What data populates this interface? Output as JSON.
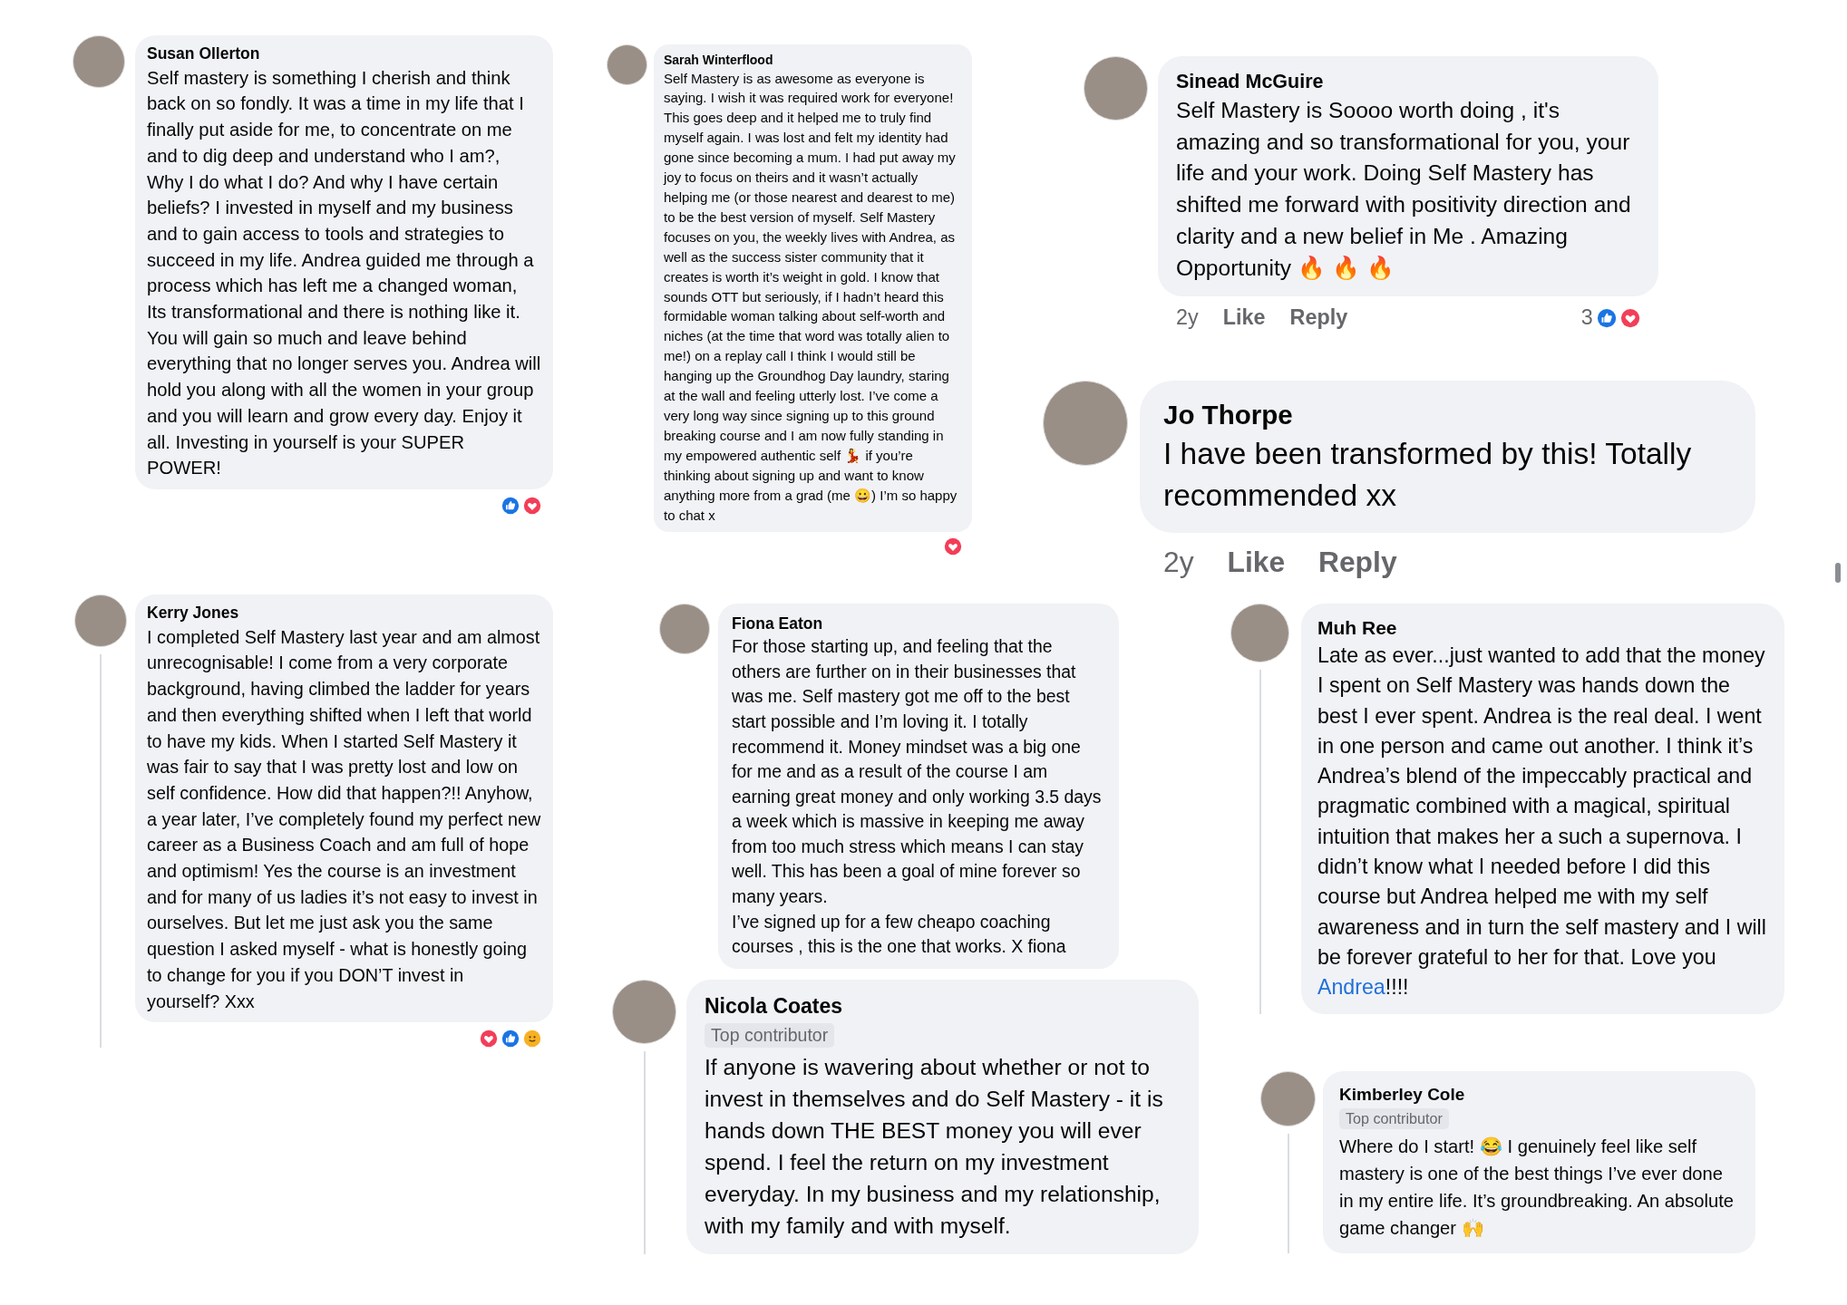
{
  "comments": [
    {
      "author": "Susan Ollerton",
      "text": "Self mastery is something I cherish and think back on so fondly. It was a time in my life that I finally put aside for me, to concentrate on me and to dig deep and understand who I am?, Why I do what I do? And why I have certain beliefs? I invested in myself and my business and to gain access to tools and strategies to succeed in my life. Andrea guided me through a process which has left me a changed woman, Its transformational and there is nothing like it. You will gain so much and leave behind everything that no longer serves you. Andrea will hold you along with all the women in your group and you will learn and grow every day. Enjoy it all. Investing in yourself is your SUPER POWER!",
      "has_replies": false,
      "footer": {
        "reactions": [
          {
            "kind": "like"
          },
          {
            "kind": "love"
          }
        ]
      }
    },
    {
      "author": "Sarah Winterflood",
      "text": "Self Mastery is as awesome as everyone is saying. I wish it was required work for everyone! This goes deep and it helped me to truly find myself again. I was lost and felt my identity had gone since becoming a mum. I had put away my joy to focus on theirs and it wasn’t actually helping me (or those nearest and dearest to me) to be the best version of myself. Self Mastery focuses on you, the weekly lives with Andrea, as well as the success sister community that it creates is worth it’s weight in gold. I know that sounds OTT but seriously, if I hadn’t heard this formidable woman talking about self-worth and niches (at the time that word was totally alien to me!) on a replay call I think I would still be hanging up the Groundhog Day laundry, staring at the wall and feeling utterly lost. I’ve come a very long way since signing up to this ground breaking course and I am now fully standing in my empowered authentic self 💃 if you’re thinking about signing up and want to know anything more from a grad (me 😀) I’m so happy to chat x",
      "has_replies": false,
      "footer": {
        "reactions": [
          {
            "kind": "love"
          }
        ]
      }
    },
    {
      "author": "Sinead McGuire",
      "text": "Self Mastery is Soooo worth doing , it's amazing and so transformational for you, your life and your work. Doing Self Mastery has shifted me forward with positivity direction and clarity and a new belief in Me . Amazing Opportunity 🔥 🔥 🔥",
      "has_replies": false,
      "footer": {
        "time": "2y",
        "like": "Like",
        "reply": "Reply",
        "count": "3",
        "reactions": [
          {
            "kind": "like"
          },
          {
            "kind": "love"
          }
        ]
      }
    },
    {
      "author": "Jo Thorpe",
      "text": "I have been transformed by this! Totally recommended xx",
      "has_replies": false,
      "footer": {
        "time": "2y",
        "like": "Like",
        "reply": "Reply"
      }
    },
    {
      "author": "Kerry Jones",
      "text": "I completed Self Mastery last year and am almost unrecognisable! I come from a very corporate background, having climbed the ladder for years and then everything shifted when I left that world to have my kids. When I started Self Mastery it was fair to say that I was pretty lost and low on self confidence. How did that happen?!! Anyhow, a year later, I’ve completely found my perfect new career as a Business Coach and am full of hope and optimism! Yes the course is an investment and for many of us ladies it’s not easy to invest in ourselves. But let me just ask you the same question I asked myself - what is honestly going to change for you if you DON’T invest in yourself? Xxx",
      "has_replies": true,
      "footer": {
        "reactions": [
          {
            "kind": "love"
          },
          {
            "kind": "like"
          },
          {
            "kind": "care"
          }
        ]
      }
    },
    {
      "author": "Fiona Eaton",
      "text": "For those starting up, and feeling that the others are further on in their businesses that was me. Self mastery got me off to the best start possible and I’m loving it. I totally recommend it. Money mindset was a big one for me and as a result of the course I am earning great money and only working 3.5 days a week which is massive in keeping me away from too much stress which means I can stay well. This has been a goal of mine forever so many years.\nI’ve signed up for a few cheapo coaching courses , this is the one that works. X fiona",
      "has_replies": false
    },
    {
      "author": "Nicola Coates",
      "badge": "Top contributor",
      "text": "If anyone is wavering about whether or not to invest in themselves and do Self Mastery - it is hands down THE BEST money you will ever spend. I feel the return on my investment everyday. In my business and my relationship, with my family and with myself.",
      "has_replies": true
    },
    {
      "author": "Muh Ree",
      "text": "Late as ever...just wanted to add that the money I spent on Self Mastery was hands down the best I ever spent. Andrea is the real deal. I went in one person and came out another. I think it’s Andrea’s blend of the impeccably practical and pragmatic combined with a magical, spiritual intuition that makes her a such a supernova. I didn’t know what I needed before I did this course but Andrea helped me with my self awareness and in turn the self mastery and I will be forever grateful to her for that. Love you ",
      "link": "Andrea",
      "text_after": "!!!!",
      "has_replies": true
    },
    {
      "author": "Kimberley Cole",
      "badge": "Top contributor",
      "text": "Where do I start! 😂 I genuinely feel like self mastery is one of the best things I’ve ever done in my entire life. It’s groundbreaking. An absolute game changer 🙌",
      "has_replies": true
    }
  ]
}
